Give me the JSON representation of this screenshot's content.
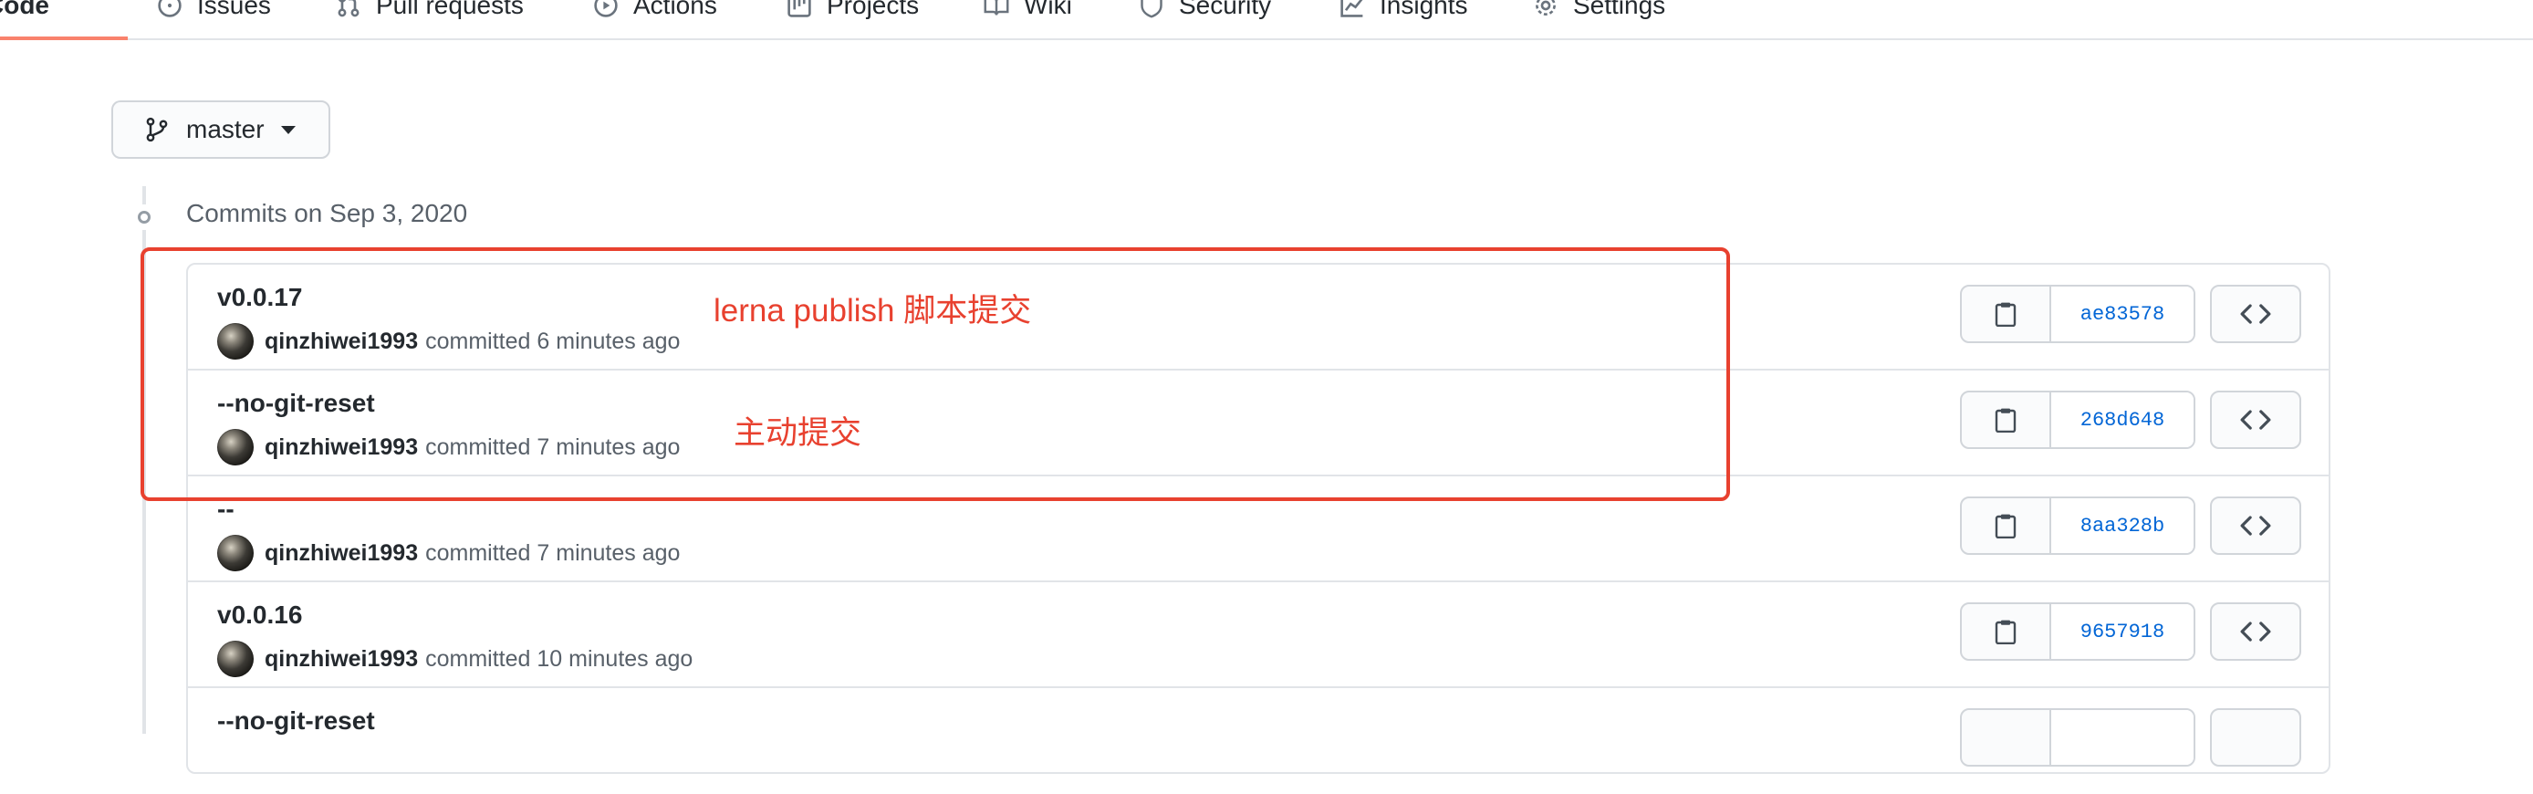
{
  "repo_nav": {
    "items": [
      {
        "label": "Code",
        "icon": "code-icon",
        "selected": true
      },
      {
        "label": "Issues",
        "icon": "issue-icon"
      },
      {
        "label": "Pull requests",
        "icon": "pull-request-icon"
      },
      {
        "label": "Actions",
        "icon": "play-icon"
      },
      {
        "label": "Projects",
        "icon": "project-icon"
      },
      {
        "label": "Wiki",
        "icon": "book-icon"
      },
      {
        "label": "Security",
        "icon": "shield-icon"
      },
      {
        "label": "Insights",
        "icon": "graph-icon"
      },
      {
        "label": "Settings",
        "icon": "gear-icon"
      }
    ],
    "selected_color": "#f9826c"
  },
  "branch": {
    "name": "master",
    "icon": "git-branch-icon"
  },
  "commits_group": {
    "heading": "Commits on Sep 3, 2020",
    "commits": [
      {
        "message": "v0.0.17",
        "author": "qinzhiwei1993",
        "action": "committed",
        "time": "6 minutes ago",
        "sha": "ae83578"
      },
      {
        "message": "--no-git-reset",
        "author": "qinzhiwei1993",
        "action": "committed",
        "time": "7 minutes ago",
        "sha": "268d648"
      },
      {
        "message": "--",
        "author": "qinzhiwei1993",
        "action": "committed",
        "time": "7 minutes ago",
        "sha": "8aa328b"
      },
      {
        "message": "v0.0.16",
        "author": "qinzhiwei1993",
        "action": "committed",
        "time": "10 minutes ago",
        "sha": "9657918"
      },
      {
        "message": "--no-git-reset",
        "author": "",
        "action": "",
        "time": "",
        "sha": ""
      }
    ]
  },
  "annotations": {
    "color": "#e8412f",
    "labels": [
      "lerna publish 脚本提交",
      "主动提交"
    ]
  }
}
